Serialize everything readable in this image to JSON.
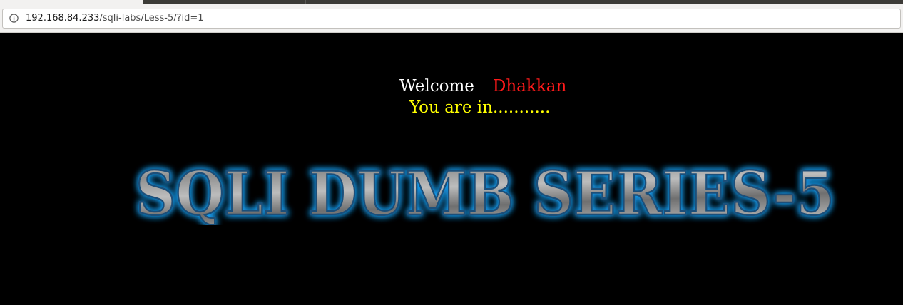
{
  "browser": {
    "address_host": "192.168.84.233",
    "address_path": "/sqli-labs/Less-5/?id=1",
    "info_icon": "info-circle-icon"
  },
  "page": {
    "welcome_text": "Welcome",
    "username": "Dhakkan",
    "status_message": "You are in...........",
    "banner_title": "SQLI DUMB SERIES-5"
  },
  "colors": {
    "background": "#000000",
    "welcome": "#ffffff",
    "username": "#ff1a1a",
    "status": "#ffff00",
    "banner_glow": "#1ea7ff",
    "banner_fill": "#8c8c8c"
  }
}
